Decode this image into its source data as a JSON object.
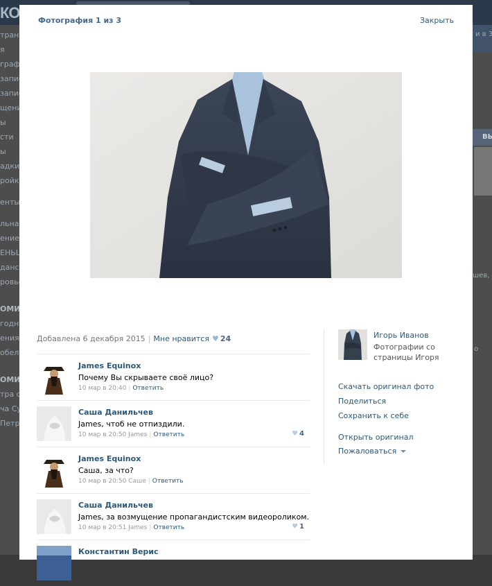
{
  "background": {
    "logo": "КОН",
    "menu": [
      "траниц",
      "я",
      "графии",
      "запис",
      "запис",
      "щения",
      "ы",
      "сти",
      "ы",
      "адки",
      "ройки"
    ],
    "menu2": [
      "енты"
    ],
    "menu3": [
      "льная",
      "ение з",
      "ЕНЬШ",
      "данск",
      "ровье"
    ],
    "menu4_title": "ОМИ",
    "menu4": [
      "годня",
      "ения",
      "обел"
    ],
    "menu5_title": "ОМИ",
    "menu5": [
      "тра со",
      "ча Су",
      "Петр"
    ],
    "right_texts": [
      "и в 3",
      "ВЫ",
      "шев,",
      "о"
    ]
  },
  "modal": {
    "title": "Фотография 1 из 3",
    "close": "Закрыть",
    "added": "Добавлена 6 декабря 2015",
    "like_label": "Мне нравится",
    "like_count": "24",
    "comments": [
      {
        "name": "James Equinox",
        "text": "Почему Вы скрываете своё лицо?",
        "date": "10 мар в 20:40",
        "to": "",
        "reply": "Ответить",
        "likes": "",
        "avatar": "pirate"
      },
      {
        "name": "Саша Данильчев",
        "text": "James, чтоб не отпиздили.",
        "date": "10 мар в 20:50",
        "to": "James",
        "reply": "Ответить",
        "likes": "4",
        "avatar": "statue"
      },
      {
        "name": "James Equinox",
        "text": "Саша, за что?",
        "date": "10 мар в 20:50",
        "to": "Саше",
        "reply": "Ответить",
        "likes": "",
        "avatar": "pirate"
      },
      {
        "name": "Саша Данильчев",
        "text": "James, за возмущение пропагандистским видеороликом.",
        "date": "10 мар в 20:51",
        "to": "James",
        "reply": "Ответить",
        "likes": "1",
        "avatar": "statue"
      },
      {
        "name": "Константин Верис",
        "text": "",
        "date": "",
        "to": "",
        "reply": "",
        "likes": "",
        "avatar": "blue"
      }
    ],
    "owner": {
      "name": "Игорь Иванов",
      "album": "Фотографии со страницы Игоря"
    },
    "actions": {
      "download": "Скачать оригинал фото",
      "share": "Поделиться",
      "save": "Сохранить к себе",
      "open": "Открыть оригинал",
      "report": "Пожаловаться"
    }
  }
}
